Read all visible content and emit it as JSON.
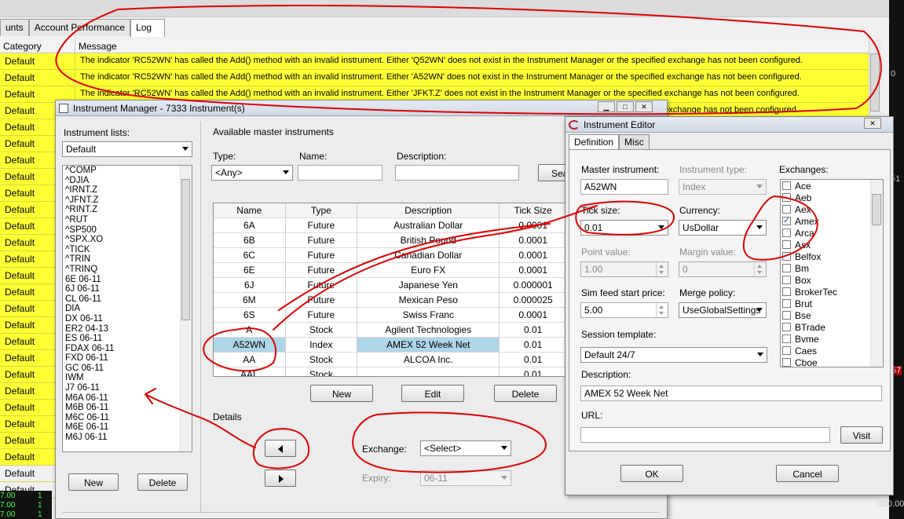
{
  "log_window": {
    "tabs": [
      {
        "label": "unts"
      },
      {
        "label": "Account Performance"
      },
      {
        "label": "Log"
      }
    ],
    "columns": {
      "category": "Category",
      "message": "Message"
    },
    "rows": [
      {
        "category": "Default",
        "message": "The indicator 'RC52WN' has called the Add() method with an invalid instrument. Either 'Q52WN' does not exist in the Instrument Manager or the specified exchange has not been configured."
      },
      {
        "category": "Default",
        "message": "The indicator 'RC52WN' has called the Add() method with an invalid instrument. Either 'A52WN' does not exist in the Instrument Manager or the specified exchange has not been configured."
      },
      {
        "category": "Default",
        "message": "The indicator 'RC52WN' has called the Add() method with an invalid instrument. Either 'JFKT.Z' does not exist in the Instrument Manager or the specified exchange has not been configured."
      },
      {
        "category": "Default",
        "message": "The indicator 'RC52WN' has called the Add() method with an invalid instrument. Either 'RIRT.Z' does not exist in the Instrument Manager or the specified exchange has not been configured."
      }
    ],
    "left_categories": [
      "Default",
      "Default",
      "Default",
      "Default",
      "Default",
      "Default",
      "Default",
      "Default",
      "Default",
      "Default",
      "Default",
      "Default",
      "Default",
      "Default",
      "Default",
      "Default",
      "Default",
      "Default",
      "Default",
      "Default",
      "Default",
      "Default",
      "Default",
      "Default",
      "Default",
      "Default",
      "Default"
    ],
    "bottom_values": [
      {
        "value": "7.00",
        "count": "1"
      },
      {
        "value": "7.00",
        "count": "1"
      },
      {
        "value": "7.00",
        "count": "1"
      }
    ],
    "right_ticks": [
      "0",
      "51",
      "57",
      "-100.00"
    ]
  },
  "instrument_manager": {
    "title": "Instrument Manager - 7333 Instrument(s)",
    "lists_label": "Instrument lists:",
    "lists_selected": "Default",
    "instruments": [
      "^COMP",
      "^DJIA",
      "^IRNT.Z",
      "^JFNT.Z",
      "^RINT.Z",
      "^RUT",
      "^SP500",
      "^SPX.XO",
      "^TICK",
      "^TRIN",
      "^TRINQ",
      "6E 06-11",
      "6J 06-11",
      "CL 06-11",
      "DIA",
      "DX 06-11",
      "ER2 04-13",
      "ES 06-11",
      "FDAX 06-11",
      "FXD 06-11",
      "GC 06-11",
      "IWM",
      "J7 06-11",
      "M6A 06-11",
      "M6B 06-11",
      "M6C 06-11",
      "M6E 06-11",
      "M6J 06-11"
    ],
    "new_label": "New",
    "delete_label": "Delete",
    "available_label": "Available master instruments",
    "type_label": "Type:",
    "type_value": "<Any>",
    "name_label": "Name:",
    "name_value": "",
    "description_label": "Description:",
    "description_value": "",
    "search_label": "Sea",
    "table": {
      "headers": {
        "name": "Name",
        "type": "Type",
        "description": "Description",
        "tick": "Tick Size"
      },
      "rows": [
        {
          "name": "6A",
          "type": "Future",
          "description": "Australian Dollar",
          "tick": "0.0001"
        },
        {
          "name": "6B",
          "type": "Future",
          "description": "British Pound",
          "tick": "0.0001"
        },
        {
          "name": "6C",
          "type": "Future",
          "description": "Canadian Dollar",
          "tick": "0.0001"
        },
        {
          "name": "6E",
          "type": "Future",
          "description": "Euro FX",
          "tick": "0.0001"
        },
        {
          "name": "6J",
          "type": "Future",
          "description": "Japanese Yen",
          "tick": "0.000001"
        },
        {
          "name": "6M",
          "type": "Future",
          "description": "Mexican Peso",
          "tick": "0.000025"
        },
        {
          "name": "6S",
          "type": "Future",
          "description": "Swiss Franc",
          "tick": "0.0001"
        },
        {
          "name": "A",
          "type": "Stock",
          "description": "Agilent Technologies",
          "tick": "0.01"
        },
        {
          "name": "A52WN",
          "type": "Index",
          "description": "AMEX 52 Week Net",
          "tick": "0.01"
        },
        {
          "name": "AA",
          "type": "Stock",
          "description": "ALCOA Inc.",
          "tick": "0.01"
        },
        {
          "name": "AAL",
          "type": "Stock",
          "description": "",
          "tick": "0.01"
        }
      ]
    },
    "table_new": "New",
    "table_edit": "Edit",
    "table_delete": "Delete",
    "details_label": "Details",
    "exchange_label": "Exchange:",
    "exchange_value": "<Select>",
    "expiry_label": "Expiry:",
    "expiry_value": "06-11"
  },
  "instrument_editor": {
    "title": "Instrument Editor",
    "tabs": [
      {
        "label": "Definition"
      },
      {
        "label": "Misc"
      }
    ],
    "master_label": "Master instrument:",
    "master_value": "A52WN",
    "itype_label": "Instrument type:",
    "itype_value": "Index",
    "exchanges_label": "Exchanges:",
    "tick_label": "Tick size:",
    "tick_value": "0.01",
    "currency_label": "Currency:",
    "currency_value": "UsDollar",
    "point_label": "Point value:",
    "point_value": "1.00",
    "margin_label": "Margin value:",
    "margin_value": "0",
    "sim_label": "Sim feed start price:",
    "sim_value": "5.00",
    "merge_label": "Merge policy:",
    "merge_value": "UseGlobalSettings",
    "session_label": "Session template:",
    "session_value": "Default 24/7",
    "desc_label": "Description:",
    "desc_value": "AMEX 52 Week Net",
    "url_label": "URL:",
    "url_value": "",
    "visit_label": "Visit",
    "ok_label": "OK",
    "cancel_label": "Cancel",
    "exchanges": [
      {
        "name": "Ace",
        "checked": false
      },
      {
        "name": "Aeb",
        "checked": false
      },
      {
        "name": "Aex",
        "checked": false
      },
      {
        "name": "Amex",
        "checked": true
      },
      {
        "name": "Arca",
        "checked": false
      },
      {
        "name": "Asx",
        "checked": false
      },
      {
        "name": "Belfox",
        "checked": false
      },
      {
        "name": "Bm",
        "checked": false
      },
      {
        "name": "Box",
        "checked": false
      },
      {
        "name": "BrokerTec",
        "checked": false
      },
      {
        "name": "Brut",
        "checked": false
      },
      {
        "name": "Bse",
        "checked": false
      },
      {
        "name": "BTrade",
        "checked": false
      },
      {
        "name": "Bvme",
        "checked": false
      },
      {
        "name": "Caes",
        "checked": false
      },
      {
        "name": "Cboe",
        "checked": false
      }
    ]
  },
  "colors": {
    "log_highlight": "#ffff33",
    "selection": "#aed6ea",
    "annotation": "#e00000"
  }
}
